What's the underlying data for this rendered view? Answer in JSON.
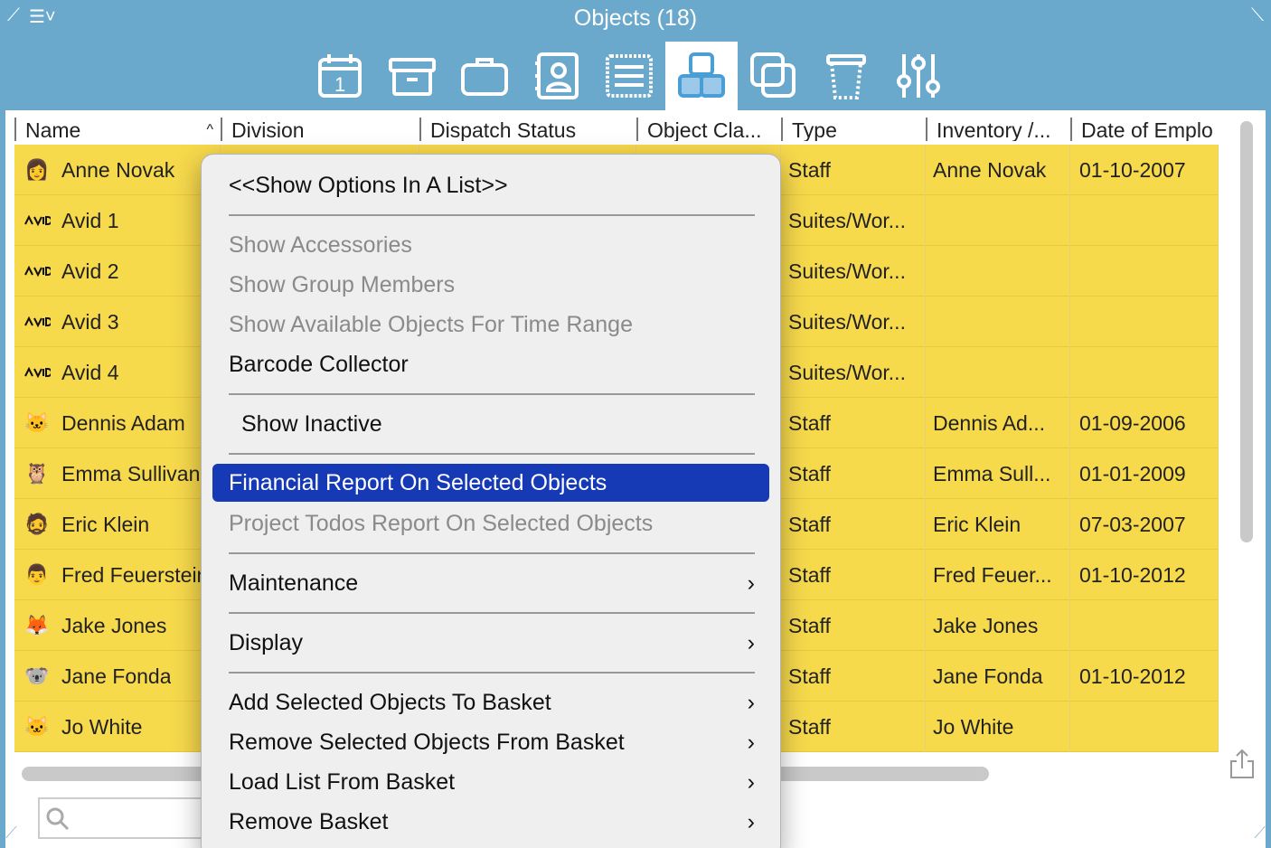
{
  "window": {
    "title": "Objects (18)"
  },
  "toolbar": {
    "tools": [
      {
        "name": "calendar-icon",
        "active": false
      },
      {
        "name": "archive-box-icon",
        "active": false
      },
      {
        "name": "briefcase-icon",
        "active": false
      },
      {
        "name": "contacts-icon",
        "active": false
      },
      {
        "name": "list-icon",
        "active": false
      },
      {
        "name": "objects-icon",
        "active": true
      },
      {
        "name": "copy-icon",
        "active": false
      },
      {
        "name": "trash-icon",
        "active": false
      },
      {
        "name": "sliders-icon",
        "active": false
      }
    ]
  },
  "table": {
    "headers": [
      "Name",
      "Division",
      "Dispatch Status",
      "Object Cla...",
      "Type",
      "Inventory /...",
      "Date of Emplo"
    ],
    "sort_indicator": "^",
    "rows": [
      {
        "icon": "👩",
        "name": "Anne Novak",
        "type": "Staff",
        "inventory": "Anne Novak",
        "date": "01-10-2007"
      },
      {
        "icon": "avid",
        "name": "Avid 1",
        "type": "Suites/Wor...",
        "inventory": "",
        "date": ""
      },
      {
        "icon": "avid",
        "name": "Avid 2",
        "type": "Suites/Wor...",
        "inventory": "",
        "date": ""
      },
      {
        "icon": "avid",
        "name": "Avid 3",
        "type": "Suites/Wor...",
        "inventory": "",
        "date": ""
      },
      {
        "icon": "avid",
        "name": "Avid 4",
        "type": "Suites/Wor...",
        "inventory": "",
        "date": ""
      },
      {
        "icon": "🐱",
        "name": "Dennis Adam",
        "type": "Staff",
        "inventory": "Dennis Ad...",
        "date": "01-09-2006"
      },
      {
        "icon": "🦉",
        "name": "Emma Sullivan",
        "type": "Staff",
        "inventory": "Emma Sull...",
        "date": "01-01-2009"
      },
      {
        "icon": "🧔",
        "name": "Eric Klein",
        "type": "Staff",
        "inventory": "Eric Klein",
        "date": "07-03-2007"
      },
      {
        "icon": "👨",
        "name": "Fred Feuerstein",
        "type": "Staff",
        "inventory": "Fred Feuer...",
        "date": "01-10-2012"
      },
      {
        "icon": "🦊",
        "name": "Jake Jones",
        "type": "Staff",
        "inventory": "Jake Jones",
        "date": ""
      },
      {
        "icon": "🐨",
        "name": "Jane Fonda",
        "type": "Staff",
        "inventory": "Jane Fonda",
        "date": "01-10-2012"
      },
      {
        "icon": "🐱",
        "name": "Jo White",
        "type": "Staff",
        "inventory": "Jo White",
        "date": ""
      }
    ]
  },
  "menu": {
    "show_options": "<<Show Options In A List>>",
    "show_accessories": "Show Accessories",
    "show_group_members": "Show Group Members",
    "show_available": "Show Available Objects For Time Range",
    "barcode": "Barcode Collector",
    "show_inactive": "Show Inactive",
    "financial_report": "Financial Report On Selected Objects",
    "project_todos": "Project Todos Report On Selected Objects",
    "maintenance": "Maintenance",
    "display": "Display",
    "add_basket": "Add Selected Objects To Basket",
    "remove_from_basket": "Remove Selected Objects From Basket",
    "load_basket": "Load List From Basket",
    "remove_basket": "Remove Basket",
    "submenu_arrow": "›"
  },
  "colors": {
    "row_bg": "#f7d94c",
    "titlebar_bg": "#6aa9cb",
    "highlight": "#1639b5"
  }
}
